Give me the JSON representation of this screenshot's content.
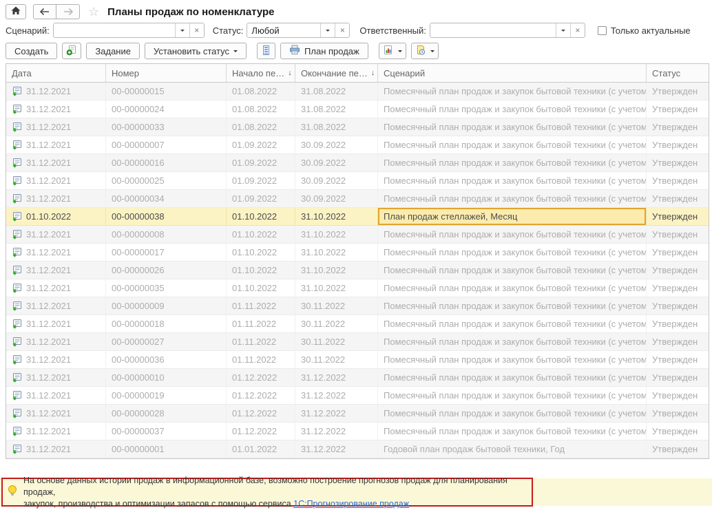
{
  "topbar": {
    "title": "Планы продаж по номенклатуре"
  },
  "filters": {
    "scenario": {
      "label": "Сценарий:",
      "value": ""
    },
    "status": {
      "label": "Статус:",
      "value": "Любой"
    },
    "responsible": {
      "label": "Ответственный:",
      "value": ""
    },
    "only_actual": {
      "label": "Только актуальные",
      "checked": false
    }
  },
  "toolbar": {
    "create": "Создать",
    "task": "Задание",
    "set_status": "Установить статус",
    "print_plan": "План продаж"
  },
  "icons": {
    "home": "home-icon",
    "back": "arrow-left-icon",
    "forward": "arrow-right-icon",
    "favorite": "star-icon",
    "copy": "create-copy-icon",
    "list": "list-view-icon",
    "printer": "printer-icon",
    "report": "report-chart-icon",
    "schedule": "document-clock-icon",
    "row": "posted-document-icon",
    "bulb": "lightbulb-icon"
  },
  "table": {
    "column_keys": [
      "date",
      "number",
      "period-start",
      "period-end",
      "scenario",
      "status"
    ],
    "columns": [
      {
        "label": "Дата",
        "sort": ""
      },
      {
        "label": "Номер",
        "sort": ""
      },
      {
        "label": "Начало пе…",
        "sort": "↓"
      },
      {
        "label": "Окончание пе…",
        "sort": "↓"
      },
      {
        "label": "Сценарий",
        "sort": ""
      },
      {
        "label": "Статус",
        "sort": ""
      }
    ],
    "selected_index": 7,
    "active_cell_col": 4,
    "rows": [
      [
        "31.12.2021",
        "00-00000015",
        "01.08.2022",
        "31.08.2022",
        "Помесячный план продаж и закупок бытовой техники (с учетом сез…",
        "Утвержден"
      ],
      [
        "31.12.2021",
        "00-00000024",
        "01.08.2022",
        "31.08.2022",
        "Помесячный план продаж и закупок бытовой техники (с учетом сез…",
        "Утвержден"
      ],
      [
        "31.12.2021",
        "00-00000033",
        "01.08.2022",
        "31.08.2022",
        "Помесячный план продаж и закупок бытовой техники (с учетом сез…",
        "Утвержден"
      ],
      [
        "31.12.2021",
        "00-00000007",
        "01.09.2022",
        "30.09.2022",
        "Помесячный план продаж и закупок бытовой техники (с учетом сез…",
        "Утвержден"
      ],
      [
        "31.12.2021",
        "00-00000016",
        "01.09.2022",
        "30.09.2022",
        "Помесячный план продаж и закупок бытовой техники (с учетом сез…",
        "Утвержден"
      ],
      [
        "31.12.2021",
        "00-00000025",
        "01.09.2022",
        "30.09.2022",
        "Помесячный план продаж и закупок бытовой техники (с учетом сез…",
        "Утвержден"
      ],
      [
        "31.12.2021",
        "00-00000034",
        "01.09.2022",
        "30.09.2022",
        "Помесячный план продаж и закупок бытовой техники (с учетом сез…",
        "Утвержден"
      ],
      [
        "01.10.2022",
        "00-00000038",
        "01.10.2022",
        "31.10.2022",
        "План продаж стеллажей, Месяц",
        "Утвержден"
      ],
      [
        "31.12.2021",
        "00-00000008",
        "01.10.2022",
        "31.10.2022",
        "Помесячный план продаж и закупок бытовой техники (с учетом сез…",
        "Утвержден"
      ],
      [
        "31.12.2021",
        "00-00000017",
        "01.10.2022",
        "31.10.2022",
        "Помесячный план продаж и закупок бытовой техники (с учетом сез…",
        "Утвержден"
      ],
      [
        "31.12.2021",
        "00-00000026",
        "01.10.2022",
        "31.10.2022",
        "Помесячный план продаж и закупок бытовой техники (с учетом сез…",
        "Утвержден"
      ],
      [
        "31.12.2021",
        "00-00000035",
        "01.10.2022",
        "31.10.2022",
        "Помесячный план продаж и закупок бытовой техники (с учетом сез…",
        "Утвержден"
      ],
      [
        "31.12.2021",
        "00-00000009",
        "01.11.2022",
        "30.11.2022",
        "Помесячный план продаж и закупок бытовой техники (с учетом сез…",
        "Утвержден"
      ],
      [
        "31.12.2021",
        "00-00000018",
        "01.11.2022",
        "30.11.2022",
        "Помесячный план продаж и закупок бытовой техники (с учетом сез…",
        "Утвержден"
      ],
      [
        "31.12.2021",
        "00-00000027",
        "01.11.2022",
        "30.11.2022",
        "Помесячный план продаж и закупок бытовой техники (с учетом сез…",
        "Утвержден"
      ],
      [
        "31.12.2021",
        "00-00000036",
        "01.11.2022",
        "30.11.2022",
        "Помесячный план продаж и закупок бытовой техники (с учетом сез…",
        "Утвержден"
      ],
      [
        "31.12.2021",
        "00-00000010",
        "01.12.2022",
        "31.12.2022",
        "Помесячный план продаж и закупок бытовой техники (с учетом сез…",
        "Утвержден"
      ],
      [
        "31.12.2021",
        "00-00000019",
        "01.12.2022",
        "31.12.2022",
        "Помесячный план продаж и закупок бытовой техники (с учетом сез…",
        "Утвержден"
      ],
      [
        "31.12.2021",
        "00-00000028",
        "01.12.2022",
        "31.12.2022",
        "Помесячный план продаж и закупок бытовой техники (с учетом сез…",
        "Утвержден"
      ],
      [
        "31.12.2021",
        "00-00000037",
        "01.12.2022",
        "31.12.2022",
        "Помесячный план продаж и закупок бытовой техники (с учетом сез…",
        "Утвержден"
      ],
      [
        "31.12.2021",
        "00-00000001",
        "01.01.2022",
        "31.12.2022",
        "Годовой план продаж бытовой техники, Год",
        "Утвержден"
      ]
    ]
  },
  "info_bar": {
    "line1": "На основе данных истории продаж в информационной базе, возможно построение прогнозов продаж для планирования продаж,",
    "line2_prefix": "закупок, производства и оптимизации запасов с помощью сервиса ",
    "link_text": "1С:Прогнозирование продаж",
    "line2_suffix": "."
  },
  "colors": {
    "selected_row_bg": "#fcf3c5",
    "active_cell_border": "#e1a42e",
    "info_bar_bg": "#fbf8d8",
    "highlight_border": "#c51a1a",
    "link": "#2e67c5",
    "posted_arrow_green": "#2fa726"
  }
}
